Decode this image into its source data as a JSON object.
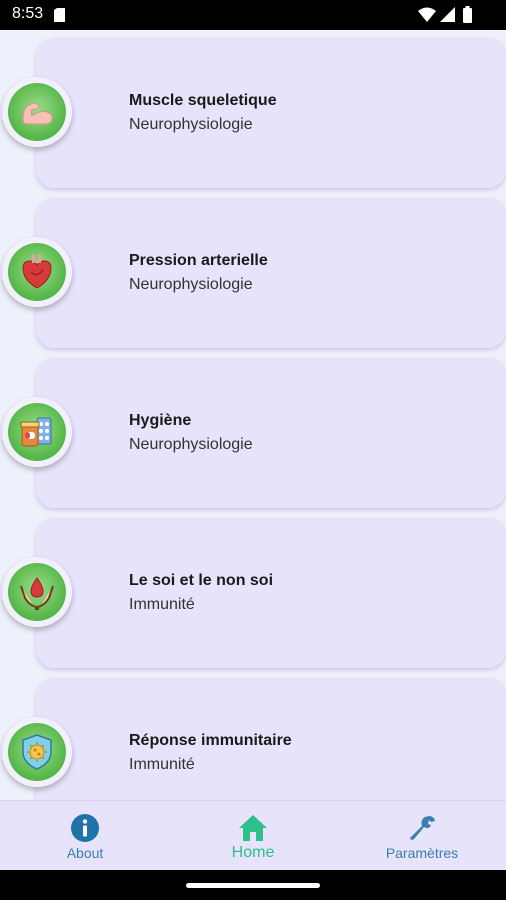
{
  "status_bar": {
    "time": "8:53"
  },
  "topics": [
    {
      "title": "Muscle squeletique",
      "category": "Neurophysiologie",
      "icon": "flexed-arm-icon"
    },
    {
      "title": "Pression arterielle",
      "category": "Neurophysiologie",
      "icon": "heart-organ-icon"
    },
    {
      "title": "Hygiène",
      "category": "Neurophysiologie",
      "icon": "medicine-bottle-pills-icon"
    },
    {
      "title": "Le soi et le non soi",
      "category": "Immunité",
      "icon": "hands-blood-drop-icon"
    },
    {
      "title": "Réponse immunitaire",
      "category": "Immunité",
      "icon": "shield-virus-icon"
    }
  ],
  "bottom_nav": {
    "about": "About",
    "home": "Home",
    "settings": "Paramètres"
  },
  "colors": {
    "card": "#e6e3fb",
    "background": "#eef0fb",
    "badge_green": "#5dbb4f",
    "active_tab": "#2ec08a",
    "inactive_tab": "#3a7fb0"
  }
}
